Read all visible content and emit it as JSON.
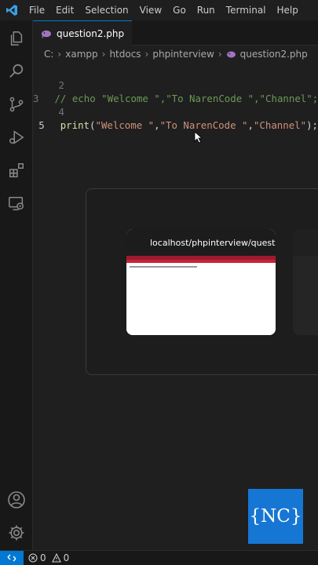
{
  "menu": [
    "File",
    "Edit",
    "Selection",
    "View",
    "Go",
    "Run",
    "Terminal",
    "Help"
  ],
  "activity_icons": [
    "explorer-icon",
    "search-icon",
    "source-control-icon",
    "run-debug-icon",
    "extensions-icon",
    "remote-explorer-icon",
    "account-icon",
    "manage-gear-icon"
  ],
  "tab": {
    "label": "question2.php"
  },
  "breadcrumb": [
    "C:",
    "xampp",
    "htdocs",
    "phpinterview",
    "question2.php"
  ],
  "code": {
    "lines": [
      {
        "num": "2",
        "tokens": []
      },
      {
        "num": "3",
        "tokens": [
          {
            "cls": "cmt",
            "text": "// echo \"Welcome \",\"To NarenCode \",\"Channel\";"
          }
        ]
      },
      {
        "num": "4",
        "tokens": []
      },
      {
        "num": "5",
        "active": true,
        "tokens": [
          {
            "cls": "fn",
            "text": "print"
          },
          {
            "cls": "punc",
            "text": "("
          },
          {
            "cls": "str",
            "text": "\"Welcome \""
          },
          {
            "cls": "punc",
            "text": ","
          },
          {
            "cls": "str",
            "text": "\"To NarenCode \""
          },
          {
            "cls": "punc",
            "text": ","
          },
          {
            "cls": "str",
            "text": "\"Channel\""
          },
          {
            "cls": "punc",
            "text": ");"
          }
        ]
      }
    ]
  },
  "window_switcher": {
    "card_title": "localhost/phpinterview/quest..."
  },
  "logo": {
    "text": "{NC}"
  },
  "status": {
    "errors": "0",
    "warnings": "0"
  },
  "colors": {
    "accent": "#0078d4",
    "logo_bg": "#1676d3",
    "comment": "#6a9955",
    "string": "#ce9178",
    "function": "#dcdcaa"
  }
}
